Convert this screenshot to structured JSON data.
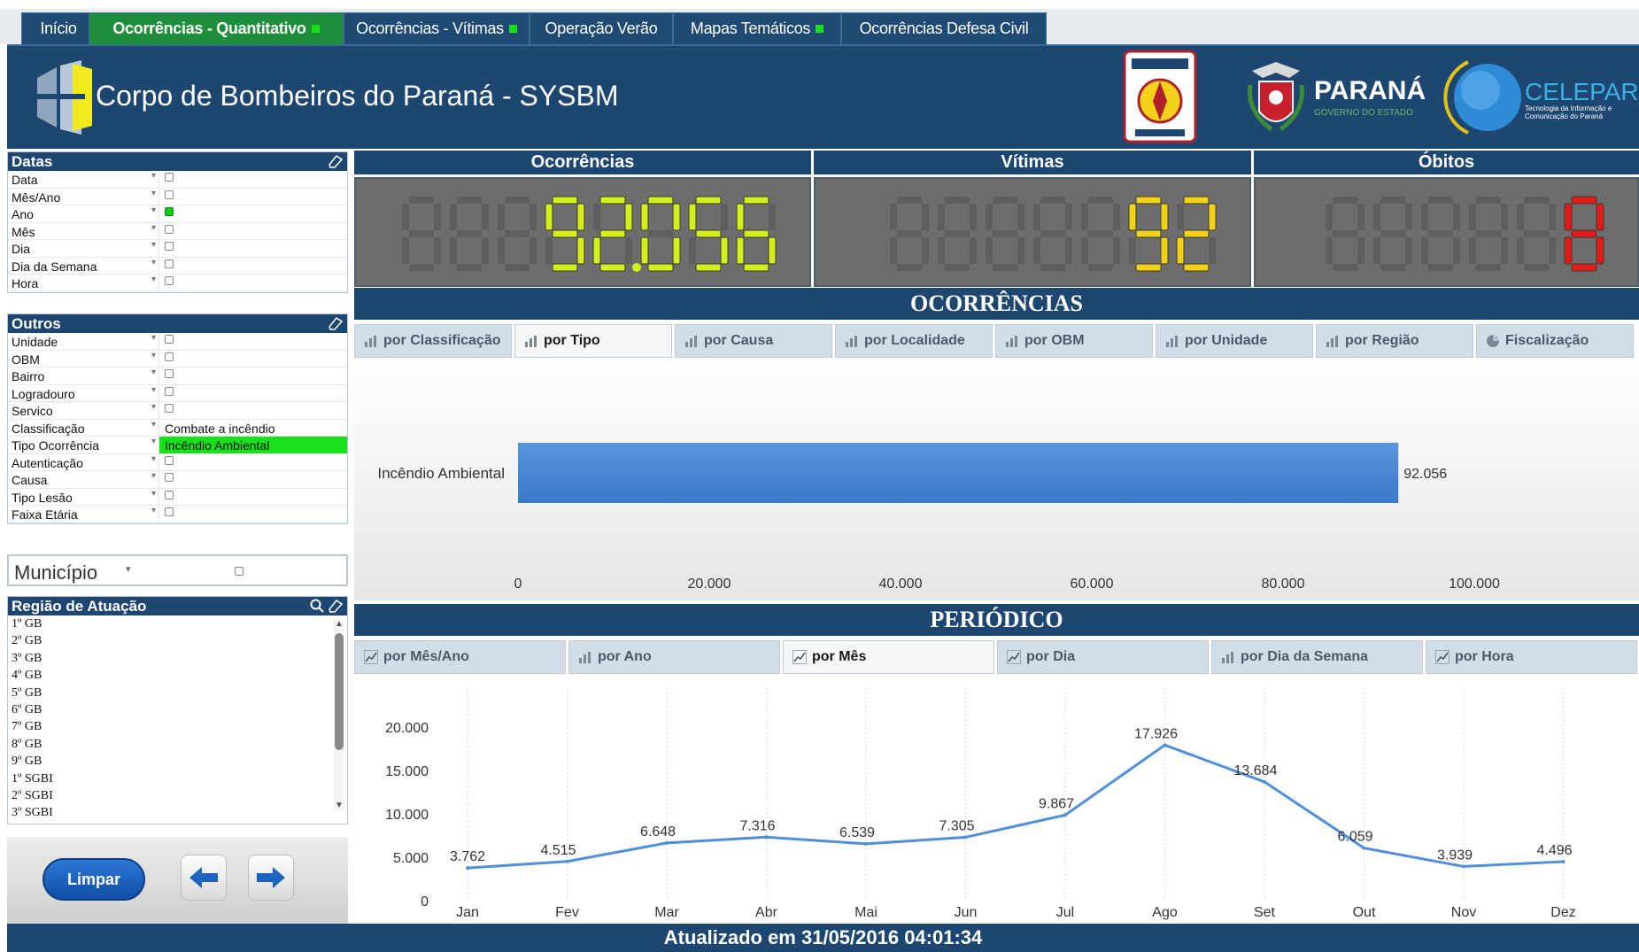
{
  "tabs": [
    {
      "label": "Início",
      "active": false,
      "dot": false
    },
    {
      "label": "Ocorrências - Quantitativo",
      "active": true,
      "dot": true
    },
    {
      "label": "Ocorrências - Vítimas",
      "active": false,
      "dot": true
    },
    {
      "label": "Operação Verão",
      "active": false,
      "dot": false
    },
    {
      "label": "Mapas Temáticos",
      "active": false,
      "dot": true
    },
    {
      "label": "Ocorrências Defesa Civil",
      "active": false,
      "dot": false
    }
  ],
  "header": {
    "title": "Corpo de Bombeiros do Paraná - SYSBM",
    "parana": "PARANÁ",
    "parana_sub": "GOVERNO DO ESTADO",
    "celepar": "CELEPAR",
    "celepar_sub": "Tecnologia da Informação e Comunicação do Paraná"
  },
  "datas": {
    "title": "Datas",
    "rows": [
      {
        "label": "Data",
        "value": "",
        "checked": false
      },
      {
        "label": "Mês/Ano",
        "value": "",
        "checked": false
      },
      {
        "label": "Ano",
        "value": "",
        "checked": true
      },
      {
        "label": "Mês",
        "value": "",
        "checked": false
      },
      {
        "label": "Dia",
        "value": "",
        "checked": false
      },
      {
        "label": "Dia da Semana",
        "value": "",
        "checked": false
      },
      {
        "label": "Hora",
        "value": "",
        "checked": false
      }
    ]
  },
  "outros": {
    "title": "Outros",
    "rows": [
      {
        "label": "Unidade",
        "value": "",
        "highlight": false
      },
      {
        "label": "OBM",
        "value": "",
        "highlight": false
      },
      {
        "label": "Bairro",
        "value": "",
        "highlight": false
      },
      {
        "label": "Logradouro",
        "value": "",
        "highlight": false
      },
      {
        "label": "Servico",
        "value": "",
        "highlight": false
      },
      {
        "label": "Classificação",
        "value": "Combate a incêndio",
        "highlight": false
      },
      {
        "label": "Tipo Ocorrência",
        "value": "Incêndio Ambiental",
        "highlight": true
      },
      {
        "label": "Autenticação",
        "value": "",
        "highlight": false
      },
      {
        "label": "Causa",
        "value": "",
        "highlight": false
      },
      {
        "label": "Tipo Lesão",
        "value": "",
        "highlight": false
      },
      {
        "label": "Faixa Etária",
        "value": "",
        "highlight": false
      }
    ]
  },
  "municipio": {
    "label": "Município"
  },
  "regiao": {
    "title": "Região de Atuação",
    "items": [
      "1º GB",
      "2º GB",
      "3º GB",
      "4º GB",
      "5º GB",
      "6º GB",
      "7º GB",
      "8º GB",
      "9º GB",
      "1º SGBI",
      "2º SGBI",
      "3º SGBI"
    ]
  },
  "buttons": {
    "limpar": "Limpar"
  },
  "counters": [
    {
      "title": "Ocorrências",
      "value": "92.056",
      "color": "#d4ef1f"
    },
    {
      "title": "Vítimas",
      "value": "92",
      "color": "#f2d21a"
    },
    {
      "title": "Óbitos",
      "value": "8",
      "color": "#e21a1a"
    }
  ],
  "ocorrencias": {
    "title": "OCORRÊNCIAS",
    "tabs": [
      "por Classificação",
      "por Tipo",
      "por Causa",
      "por Localidade",
      "por OBM",
      "por Unidade",
      "por Região",
      "Fiscalização"
    ],
    "active_tab": 1
  },
  "periodico": {
    "title": "PERIÓDICO",
    "tabs": [
      "por Mês/Ano",
      "por Ano",
      "por Mês",
      "por Dia",
      "por Dia da Semana",
      "por Hora"
    ],
    "active_tab": 2
  },
  "footer": {
    "text": "Atualizado em 31/05/2016 04:01:34"
  },
  "chart_data": [
    {
      "type": "bar",
      "orientation": "horizontal",
      "categories": [
        "Incêndio Ambiental"
      ],
      "values": [
        92056
      ],
      "value_labels": [
        "92.056"
      ],
      "xlim": [
        0,
        100000
      ],
      "ticks": [
        "0",
        "20.000",
        "40.000",
        "60.000",
        "80.000",
        "100.000"
      ],
      "bar_color": "#3a78c9"
    },
    {
      "type": "line",
      "categories": [
        "Jan",
        "Fev",
        "Mar",
        "Abr",
        "Mai",
        "Jun",
        "Jul",
        "Ago",
        "Set",
        "Out",
        "Nov",
        "Dez"
      ],
      "values": [
        3762,
        4515,
        6648,
        7316,
        6539,
        7305,
        9867,
        17926,
        13684,
        6059,
        3939,
        4496
      ],
      "value_labels": [
        "3.762",
        "4.515",
        "6.648",
        "7.316",
        "6.539",
        "7.305",
        "9.867",
        "17.926",
        "13.684",
        "6.059",
        "3.939",
        "4.496"
      ],
      "ylim": [
        0,
        20000
      ],
      "yticks": [
        "0",
        "5.000",
        "10.000",
        "15.000",
        "20.000"
      ],
      "line_color": "#4f8fdc",
      "grid": "vertical"
    }
  ]
}
